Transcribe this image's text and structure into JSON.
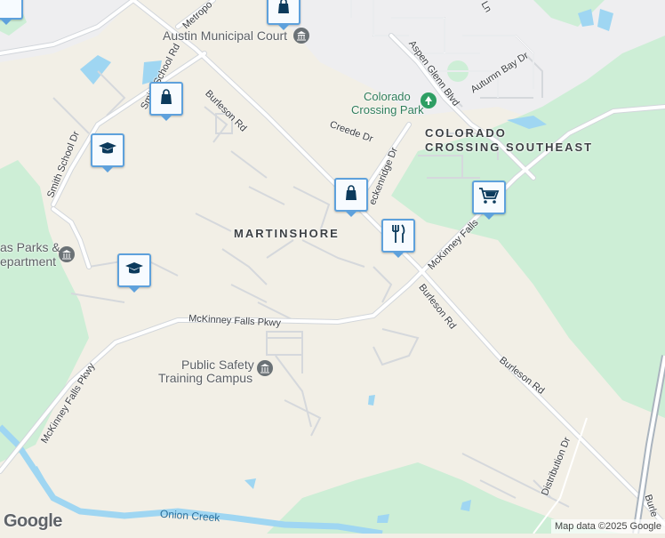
{
  "map": {
    "neighborhoods": {
      "martinshore": "MARTINSHORE",
      "colorado_crossing": "COLORADO CROSSING SOUTHEAST"
    },
    "colorado_crossing_lines": [
      "COLORADO",
      "CROSSING SOUTHEAST"
    ],
    "places": {
      "court": "Austin Municipal Court",
      "park_line1": "Colorado",
      "park_line2": "Crossing Park",
      "parks_dept_line1": "as Parks &",
      "parks_dept_line2": "epartment",
      "safety_line1": "Public Safety",
      "safety_line2": "Training Campus"
    },
    "roads": {
      "burleson_1": "Burleson Rd",
      "burleson_2": "Burleson Rd",
      "burleson_3": "Burleson Rd",
      "mckinney_1": "McKinney Falls Pkwy",
      "mckinney_2": "McKinney Falls Pkwy",
      "mckinney_3": "McKinney Falls",
      "aspen": "Aspen Glenn Blvd",
      "autumn": "Autumn Bay Dr",
      "creede": "Creede Dr",
      "breckenridge": "eckenridge Dr",
      "smith_school_1": "Smith School Rd",
      "smith_school_2": "Smith School Dr",
      "metropolis": "Metropo",
      "distribution": "Distribution Dr",
      "burle_edge": "Burle",
      "ln_edge": "Ln"
    },
    "water": {
      "onion_creek": "Onion Creek"
    },
    "pins": [
      {
        "type": "shopping",
        "icon": "shopping-bag-icon"
      },
      {
        "type": "shopping",
        "icon": "shopping-bag-icon"
      },
      {
        "type": "shopping",
        "icon": "shopping-bag-icon"
      },
      {
        "type": "school",
        "icon": "graduation-cap-icon"
      },
      {
        "type": "school",
        "icon": "graduation-cap-icon"
      },
      {
        "type": "restaurant",
        "icon": "fork-knife-icon"
      },
      {
        "type": "grocery",
        "icon": "shopping-cart-icon"
      }
    ],
    "colors": {
      "land": "#f2efe6",
      "park": "#cdeed6",
      "water": "#9fd6f2",
      "road": "#ffffff",
      "road_casing": "#c9ced3",
      "pin_border": "#5ea1dc"
    }
  },
  "branding": {
    "logo": "Google",
    "attribution": "Map data ©2025 Google"
  }
}
